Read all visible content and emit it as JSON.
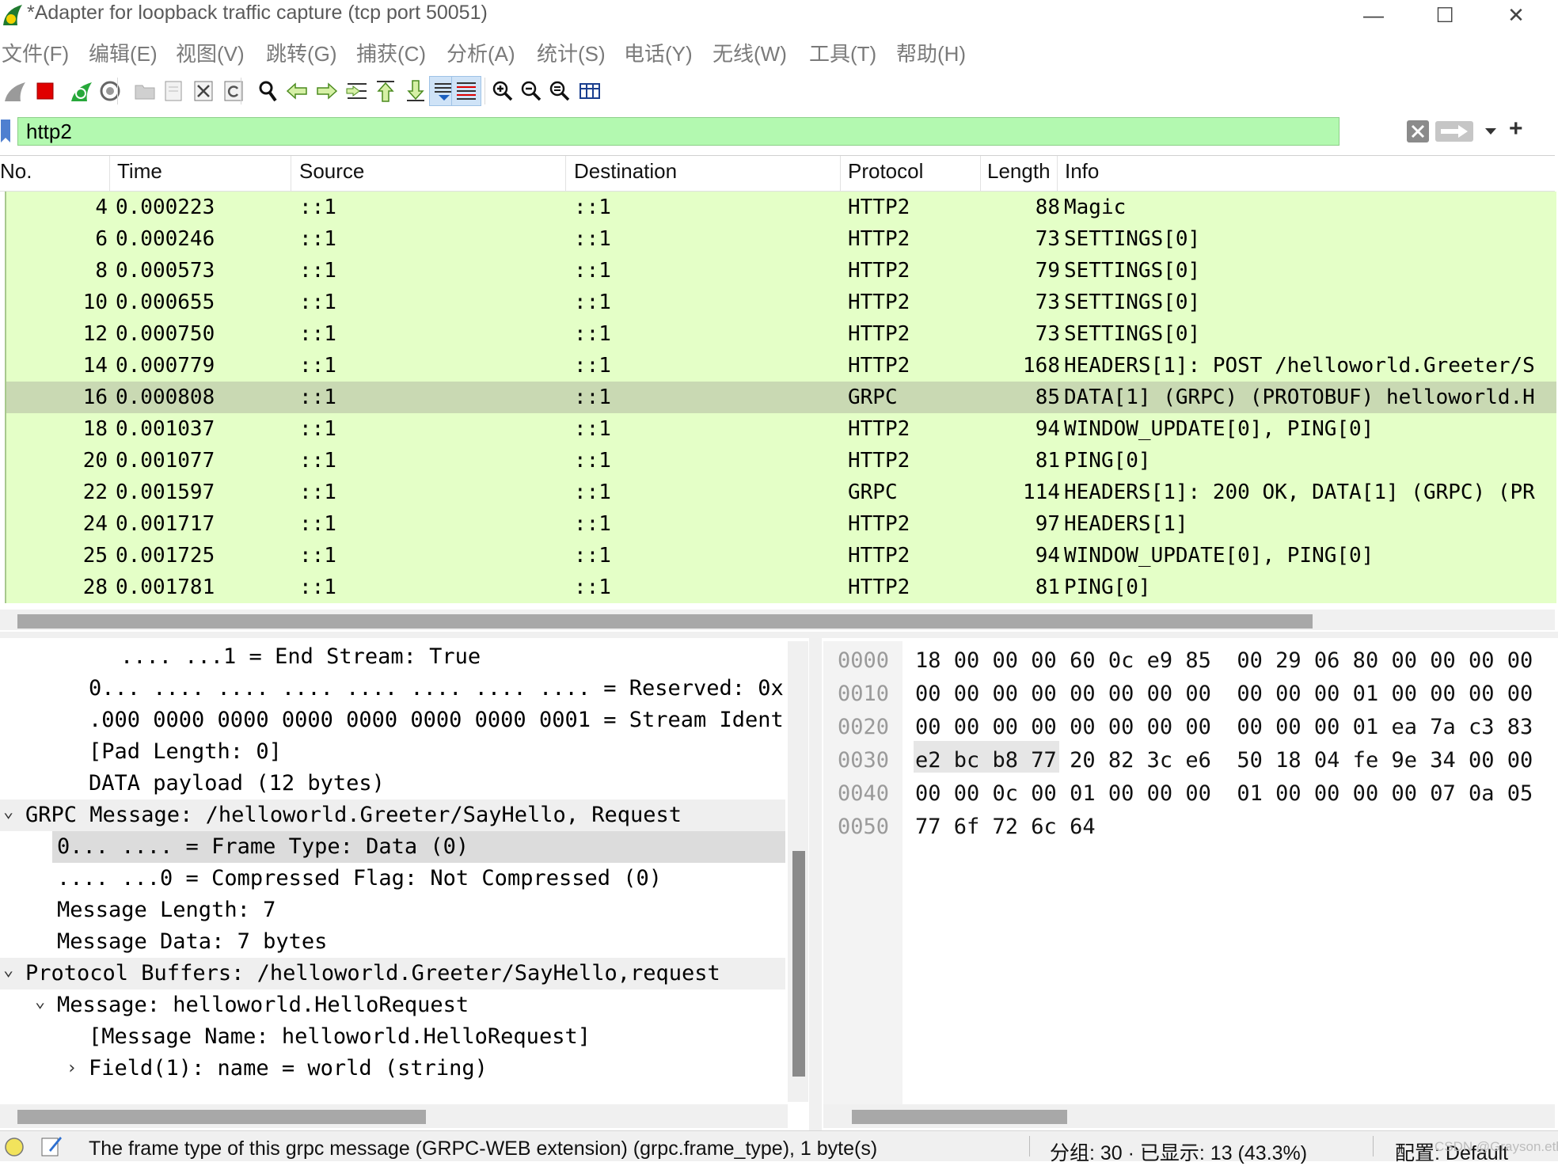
{
  "window": {
    "title": "*Adapter for loopback traffic capture (tcp port 50051)",
    "buttons": {
      "minimize": "—",
      "maximize": "☐",
      "close": "✕"
    }
  },
  "menu": [
    "文件(F)",
    "编辑(E)",
    "视图(V)",
    "跳转(G)",
    "捕获(C)",
    "分析(A)",
    "统计(S)",
    "电话(Y)",
    "无线(W)",
    "工具(T)",
    "帮助(H)"
  ],
  "toolbar": {
    "icons": [
      "shark-fin-start-icon",
      "stop-capture-icon",
      "restart-capture-icon",
      "capture-options-icon",
      "open-file-icon",
      "save-file-icon",
      "close-file-icon",
      "reload-file-icon",
      "find-packet-icon",
      "go-back-icon",
      "go-forward-icon",
      "go-to-packet-icon",
      "first-packet-icon",
      "last-packet-icon",
      "auto-scroll-icon",
      "colorize-icon",
      "zoom-in-icon",
      "zoom-out-icon",
      "normal-size-icon",
      "resize-columns-icon"
    ]
  },
  "filter": {
    "value": "http2",
    "add_button": "+"
  },
  "packet_list": {
    "columns": [
      "No.",
      "Time",
      "Source",
      "Destination",
      "Protocol",
      "Length",
      "Info"
    ],
    "rows": [
      {
        "no": "4",
        "time": "0.000223",
        "src": "::1",
        "dst": "::1",
        "proto": "HTTP2",
        "len": "88",
        "info": "Magic"
      },
      {
        "no": "6",
        "time": "0.000246",
        "src": "::1",
        "dst": "::1",
        "proto": "HTTP2",
        "len": "73",
        "info": "SETTINGS[0]"
      },
      {
        "no": "8",
        "time": "0.000573",
        "src": "::1",
        "dst": "::1",
        "proto": "HTTP2",
        "len": "79",
        "info": "SETTINGS[0]"
      },
      {
        "no": "10",
        "time": "0.000655",
        "src": "::1",
        "dst": "::1",
        "proto": "HTTP2",
        "len": "73",
        "info": "SETTINGS[0]"
      },
      {
        "no": "12",
        "time": "0.000750",
        "src": "::1",
        "dst": "::1",
        "proto": "HTTP2",
        "len": "73",
        "info": "SETTINGS[0]"
      },
      {
        "no": "14",
        "time": "0.000779",
        "src": "::1",
        "dst": "::1",
        "proto": "HTTP2",
        "len": "168",
        "info": "HEADERS[1]: POST /helloworld.Greeter/S"
      },
      {
        "no": "16",
        "time": "0.000808",
        "src": "::1",
        "dst": "::1",
        "proto": "GRPC",
        "len": "85",
        "info": "DATA[1] (GRPC) (PROTOBUF) helloworld.H",
        "selected": true
      },
      {
        "no": "18",
        "time": "0.001037",
        "src": "::1",
        "dst": "::1",
        "proto": "HTTP2",
        "len": "94",
        "info": "WINDOW_UPDATE[0], PING[0]"
      },
      {
        "no": "20",
        "time": "0.001077",
        "src": "::1",
        "dst": "::1",
        "proto": "HTTP2",
        "len": "81",
        "info": "PING[0]"
      },
      {
        "no": "22",
        "time": "0.001597",
        "src": "::1",
        "dst": "::1",
        "proto": "GRPC",
        "len": "114",
        "info": "HEADERS[1]: 200 OK, DATA[1] (GRPC) (PR"
      },
      {
        "no": "24",
        "time": "0.001717",
        "src": "::1",
        "dst": "::1",
        "proto": "HTTP2",
        "len": "97",
        "info": "HEADERS[1]"
      },
      {
        "no": "25",
        "time": "0.001725",
        "src": "::1",
        "dst": "::1",
        "proto": "HTTP2",
        "len": "94",
        "info": "WINDOW_UPDATE[0], PING[0]"
      },
      {
        "no": "28",
        "time": "0.001781",
        "src": "::1",
        "dst": "::1",
        "proto": "HTTP2",
        "len": "81",
        "info": "PING[0]"
      }
    ]
  },
  "details": [
    {
      "text": ".... ...1 = End Stream: True",
      "indent": 3,
      "style": ""
    },
    {
      "text": "0... .... .... .... .... .... .... .... = Reserved: 0x",
      "indent": 2,
      "style": ""
    },
    {
      "text": ".000 0000 0000 0000 0000 0000 0000 0001 = Stream Ident",
      "indent": 2,
      "style": ""
    },
    {
      "text": "[Pad Length: 0]",
      "indent": 2,
      "style": ""
    },
    {
      "text": "DATA payload (12 bytes)",
      "indent": 2,
      "style": ""
    },
    {
      "text": "GRPC Message: /helloworld.Greeter/SayHello, Request",
      "indent": 0,
      "style": "hl",
      "arrow": "⌄"
    },
    {
      "text": "0... .... = Frame Type: Data (0)",
      "indent": 1,
      "style": "selrow"
    },
    {
      "text": ".... ...0 = Compressed Flag: Not Compressed (0)",
      "indent": 1,
      "style": ""
    },
    {
      "text": "Message Length: 7",
      "indent": 1,
      "style": ""
    },
    {
      "text": "Message Data: 7 bytes",
      "indent": 1,
      "style": ""
    },
    {
      "text": "Protocol Buffers: /helloworld.Greeter/SayHello,request",
      "indent": 0,
      "style": "hl",
      "arrow": "⌄"
    },
    {
      "text": "Message: helloworld.HelloRequest",
      "indent": 1,
      "style": "",
      "arrow": "⌄"
    },
    {
      "text": "[Message Name: helloworld.HelloRequest]",
      "indent": 2,
      "style": ""
    },
    {
      "text": "Field(1): name = world (string)",
      "indent": 2,
      "style": "",
      "arrow": "›"
    }
  ],
  "bytes": [
    {
      "offset": "0000",
      "hex": "18 00 00 00 60 0c e9 85  00 29 06 80 00 00 00 00"
    },
    {
      "offset": "0010",
      "hex": "00 00 00 00 00 00 00 00  00 00 00 01 00 00 00 00"
    },
    {
      "offset": "0020",
      "hex": "00 00 00 00 00 00 00 00  00 00 00 01 ea 7a c3 83"
    },
    {
      "offset": "0030",
      "hex": "e2 bc b8 77 20 82 3c e6  50 18 04 fe 9e 34 00 00"
    },
    {
      "offset": "0040",
      "hex": "00 00 0c 00 01 00 00 00  01 00 00 00 00 07 0a 05"
    },
    {
      "offset": "0050",
      "hex": "77 6f 72 6c 64"
    }
  ],
  "status": {
    "field_desc": "The frame type of this grpc message (GRPC-WEB extension) (grpc.frame_type), 1 byte(s)",
    "packets": "分组: 30 · 已显示: 13 (43.3%)",
    "profile": "配置: Default",
    "watermark": "CSDN @Grayson.eth"
  },
  "colors": {
    "packet_row_bg": "#e4ffc7",
    "selected_row_bg": "#c9d9b3",
    "filter_bg": "#b3f9b0"
  }
}
